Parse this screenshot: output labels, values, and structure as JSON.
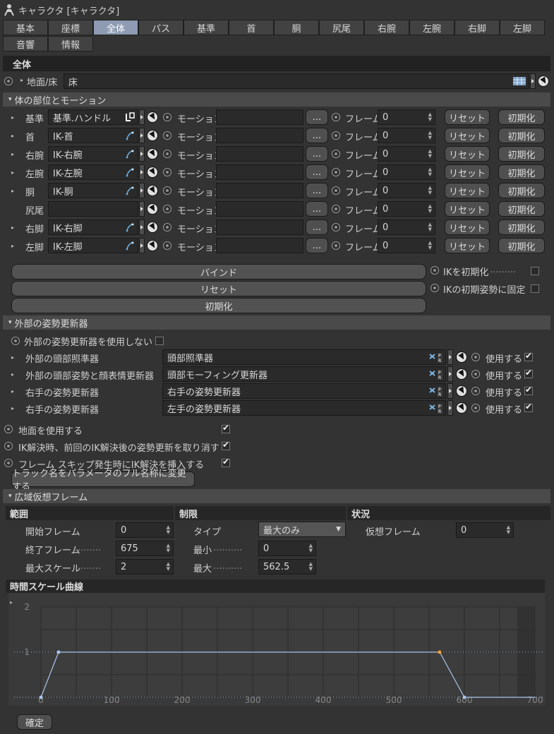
{
  "window": {
    "title": "キャラクタ [キャラクタ]"
  },
  "tabs": [
    {
      "label": "基本"
    },
    {
      "label": "座標"
    },
    {
      "label": "全体"
    },
    {
      "label": "パス"
    },
    {
      "label": "基準"
    },
    {
      "label": "首"
    },
    {
      "label": "胴"
    },
    {
      "label": "尻尾"
    },
    {
      "label": "右腕"
    },
    {
      "label": "左腕"
    },
    {
      "label": "右脚"
    },
    {
      "label": "左脚"
    },
    {
      "label": "音響"
    },
    {
      "label": "情報"
    }
  ],
  "active_tab": "全体",
  "section_title": "全体",
  "ground": {
    "label": "地面/床",
    "value": "床"
  },
  "body_parts_group": "体の部位とモーション",
  "body_parts": [
    {
      "label": "基準",
      "target": "基準.ハンドル",
      "motion_label": "モーション",
      "frame_label": "フレーム",
      "frame": "0",
      "reset": "リセット",
      "init": "初期化"
    },
    {
      "label": "首",
      "target": "IK-首",
      "motion_label": "モーション",
      "frame_label": "フレーム",
      "frame": "0",
      "reset": "リセット",
      "init": "初期化"
    },
    {
      "label": "右腕",
      "target": "IK-右腕",
      "motion_label": "モーション",
      "frame_label": "フレーム",
      "frame": "0",
      "reset": "リセット",
      "init": "初期化"
    },
    {
      "label": "左腕",
      "target": "IK-左腕",
      "motion_label": "モーション",
      "frame_label": "フレーム",
      "frame": "0",
      "reset": "リセット",
      "init": "初期化"
    },
    {
      "label": "胴",
      "target": "IK-胴",
      "motion_label": "モーション",
      "frame_label": "フレーム",
      "frame": "0",
      "reset": "リセット",
      "init": "初期化"
    },
    {
      "label": "尻尾",
      "target": "",
      "motion_label": "モーション",
      "frame_label": "フレーム",
      "frame": "0",
      "reset": "リセット",
      "init": "初期化"
    },
    {
      "label": "右脚",
      "target": "IK-右脚",
      "motion_label": "モーション",
      "frame_label": "フレーム",
      "frame": "0",
      "reset": "リセット",
      "init": "初期化"
    },
    {
      "label": "左脚",
      "target": "IK-左脚",
      "motion_label": "モーション",
      "frame_label": "フレーム",
      "frame": "0",
      "reset": "リセット",
      "init": "初期化"
    }
  ],
  "motion_button": "...",
  "actions": {
    "bind": "バインド",
    "reset": "リセット",
    "init": "初期化",
    "ik_init": "IKを初期化",
    "ik_fix": "IKの初期姿勢に固定"
  },
  "external_group": "外部の姿勢更新器",
  "external_disable": "外部の姿勢更新器を使用しない",
  "external_rows": [
    {
      "label": "外部の頭部照準器",
      "value": "頭部照準器",
      "use": "使用する"
    },
    {
      "label": "外部の頭部姿勢と顔表情更新器",
      "value": "頭部モーフィング更新器",
      "use": "使用する"
    },
    {
      "label": "右手の姿勢更新器",
      "value": "右手の姿勢更新器",
      "use": "使用する"
    },
    {
      "label": "右手の姿勢更新器",
      "value": "左手の姿勢更新器",
      "use": "使用する"
    }
  ],
  "options": [
    {
      "label": "地面を使用する",
      "checked": true
    },
    {
      "label": "IK解決時、前回のIK解決後の姿勢更新を取り消す",
      "checked": true
    },
    {
      "label": "フレーム スキップ発生時にIK解決を挿入する",
      "checked": true
    }
  ],
  "rename_button": "トラック名をパラメータのフル名称に変更する",
  "virtual_group": "広域仮想フレーム",
  "range": {
    "header": "範囲",
    "start_label": "開始フレーム",
    "start": "0",
    "end_label": "終了フレーム",
    "end": "675",
    "scale_label": "最大スケール",
    "scale": "2"
  },
  "limit": {
    "header": "制限",
    "type_label": "タイプ",
    "type": "最大のみ",
    "min_label": "最小",
    "min": "0",
    "max_label": "最大",
    "max": "562.5"
  },
  "status": {
    "header": "状況",
    "vf_label": "仮想フレーム",
    "vf": "0"
  },
  "curve_header": "時間スケール曲線",
  "chart_data": {
    "type": "line",
    "x_ticks": [
      "0",
      "100",
      "200",
      "300",
      "400",
      "500",
      "600",
      "700"
    ],
    "y_ticks": [
      "2",
      "1"
    ],
    "xlim": [
      0,
      700
    ],
    "ylim": [
      0,
      2
    ],
    "series": [
      {
        "x": [
          0,
          25,
          565,
          600,
          700
        ],
        "y": [
          0,
          1,
          1,
          0,
          0
        ]
      }
    ],
    "ref_line_y": 1,
    "highlight_point_index": 2,
    "grid": true
  },
  "ok_button": "確定"
}
